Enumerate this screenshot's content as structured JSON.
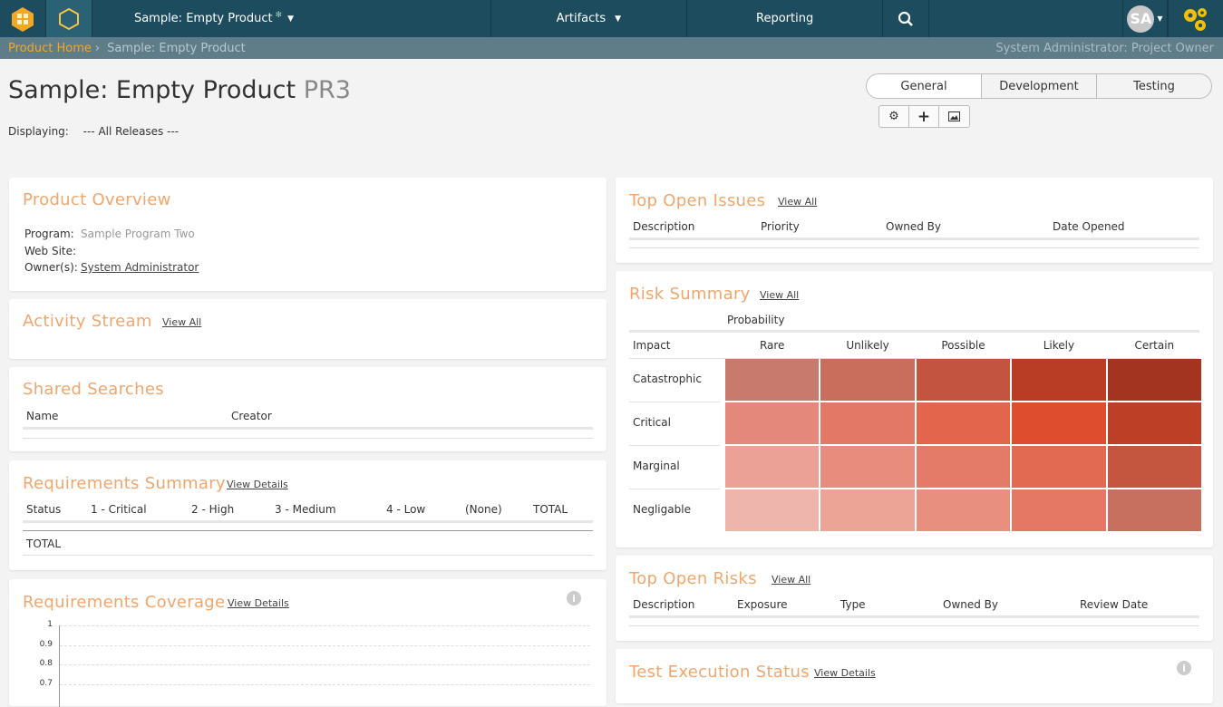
{
  "nav": {
    "product_menu": "Sample: Empty Product",
    "artifacts": "Artifacts",
    "reporting": "Reporting",
    "avatar": "SA"
  },
  "breadcrumb": {
    "home": "Product Home",
    "current": "Sample: Empty Product",
    "role": "System Administrator: Project Owner"
  },
  "page": {
    "title": "Sample: Empty Product",
    "code": "PR3",
    "displaying_label": "Displaying:",
    "displaying_value": "--- All Releases ---"
  },
  "view_tabs": [
    "General",
    "Development",
    "Testing"
  ],
  "product_overview": {
    "title": "Product Overview",
    "program_label": "Program:",
    "program_value": "Sample Program Two",
    "website_label": "Web Site:",
    "owners_label": "Owner(s):",
    "owners_value": "System Administrator"
  },
  "activity_stream": {
    "title": "Activity Stream",
    "link": "View All"
  },
  "shared_searches": {
    "title": "Shared Searches",
    "columns": [
      "Name",
      "Creator"
    ]
  },
  "requirements_summary": {
    "title": "Requirements Summary",
    "link": "View Details",
    "columns": [
      "Status",
      "1 - Critical",
      "2 - High",
      "3 - Medium",
      "4 - Low",
      "(None)",
      "TOTAL"
    ],
    "total_row": "TOTAL"
  },
  "requirements_coverage": {
    "title": "Requirements Coverage",
    "link": "View Details",
    "y_ticks": [
      "1",
      "0.9",
      "0.8",
      "0.7"
    ]
  },
  "top_open_issues": {
    "title": "Top Open Issues",
    "link": "View All",
    "columns": [
      "Description",
      "Priority",
      "Owned By",
      "Date Opened"
    ]
  },
  "risk_summary": {
    "title": "Risk Summary",
    "link": "View All",
    "probability_label": "Probability",
    "impact_label": "Impact",
    "probabilities": [
      "Rare",
      "Unlikely",
      "Possible",
      "Likely",
      "Certain"
    ],
    "impacts": [
      "Catastrophic",
      "Critical",
      "Marginal",
      "Negligable"
    ],
    "colors": [
      [
        "#c87a6c",
        "#c96d5c",
        "#c35440",
        "#b93d24",
        "#a33420"
      ],
      [
        "#e3887a",
        "#e37866",
        "#e2654c",
        "#df4d2f",
        "#bd3f25"
      ],
      [
        "#eba196",
        "#e88d7e",
        "#e47a68",
        "#e26a53",
        "#c4553f"
      ],
      [
        "#eeb5ac",
        "#eca497",
        "#e98f7f",
        "#e47865",
        "#c8705f"
      ]
    ]
  },
  "top_open_risks": {
    "title": "Top Open Risks",
    "link": "View All",
    "columns": [
      "Description",
      "Exposure",
      "Type",
      "Owned By",
      "Review Date"
    ]
  },
  "test_execution": {
    "title": "Test Execution Status",
    "link": "View Details"
  }
}
